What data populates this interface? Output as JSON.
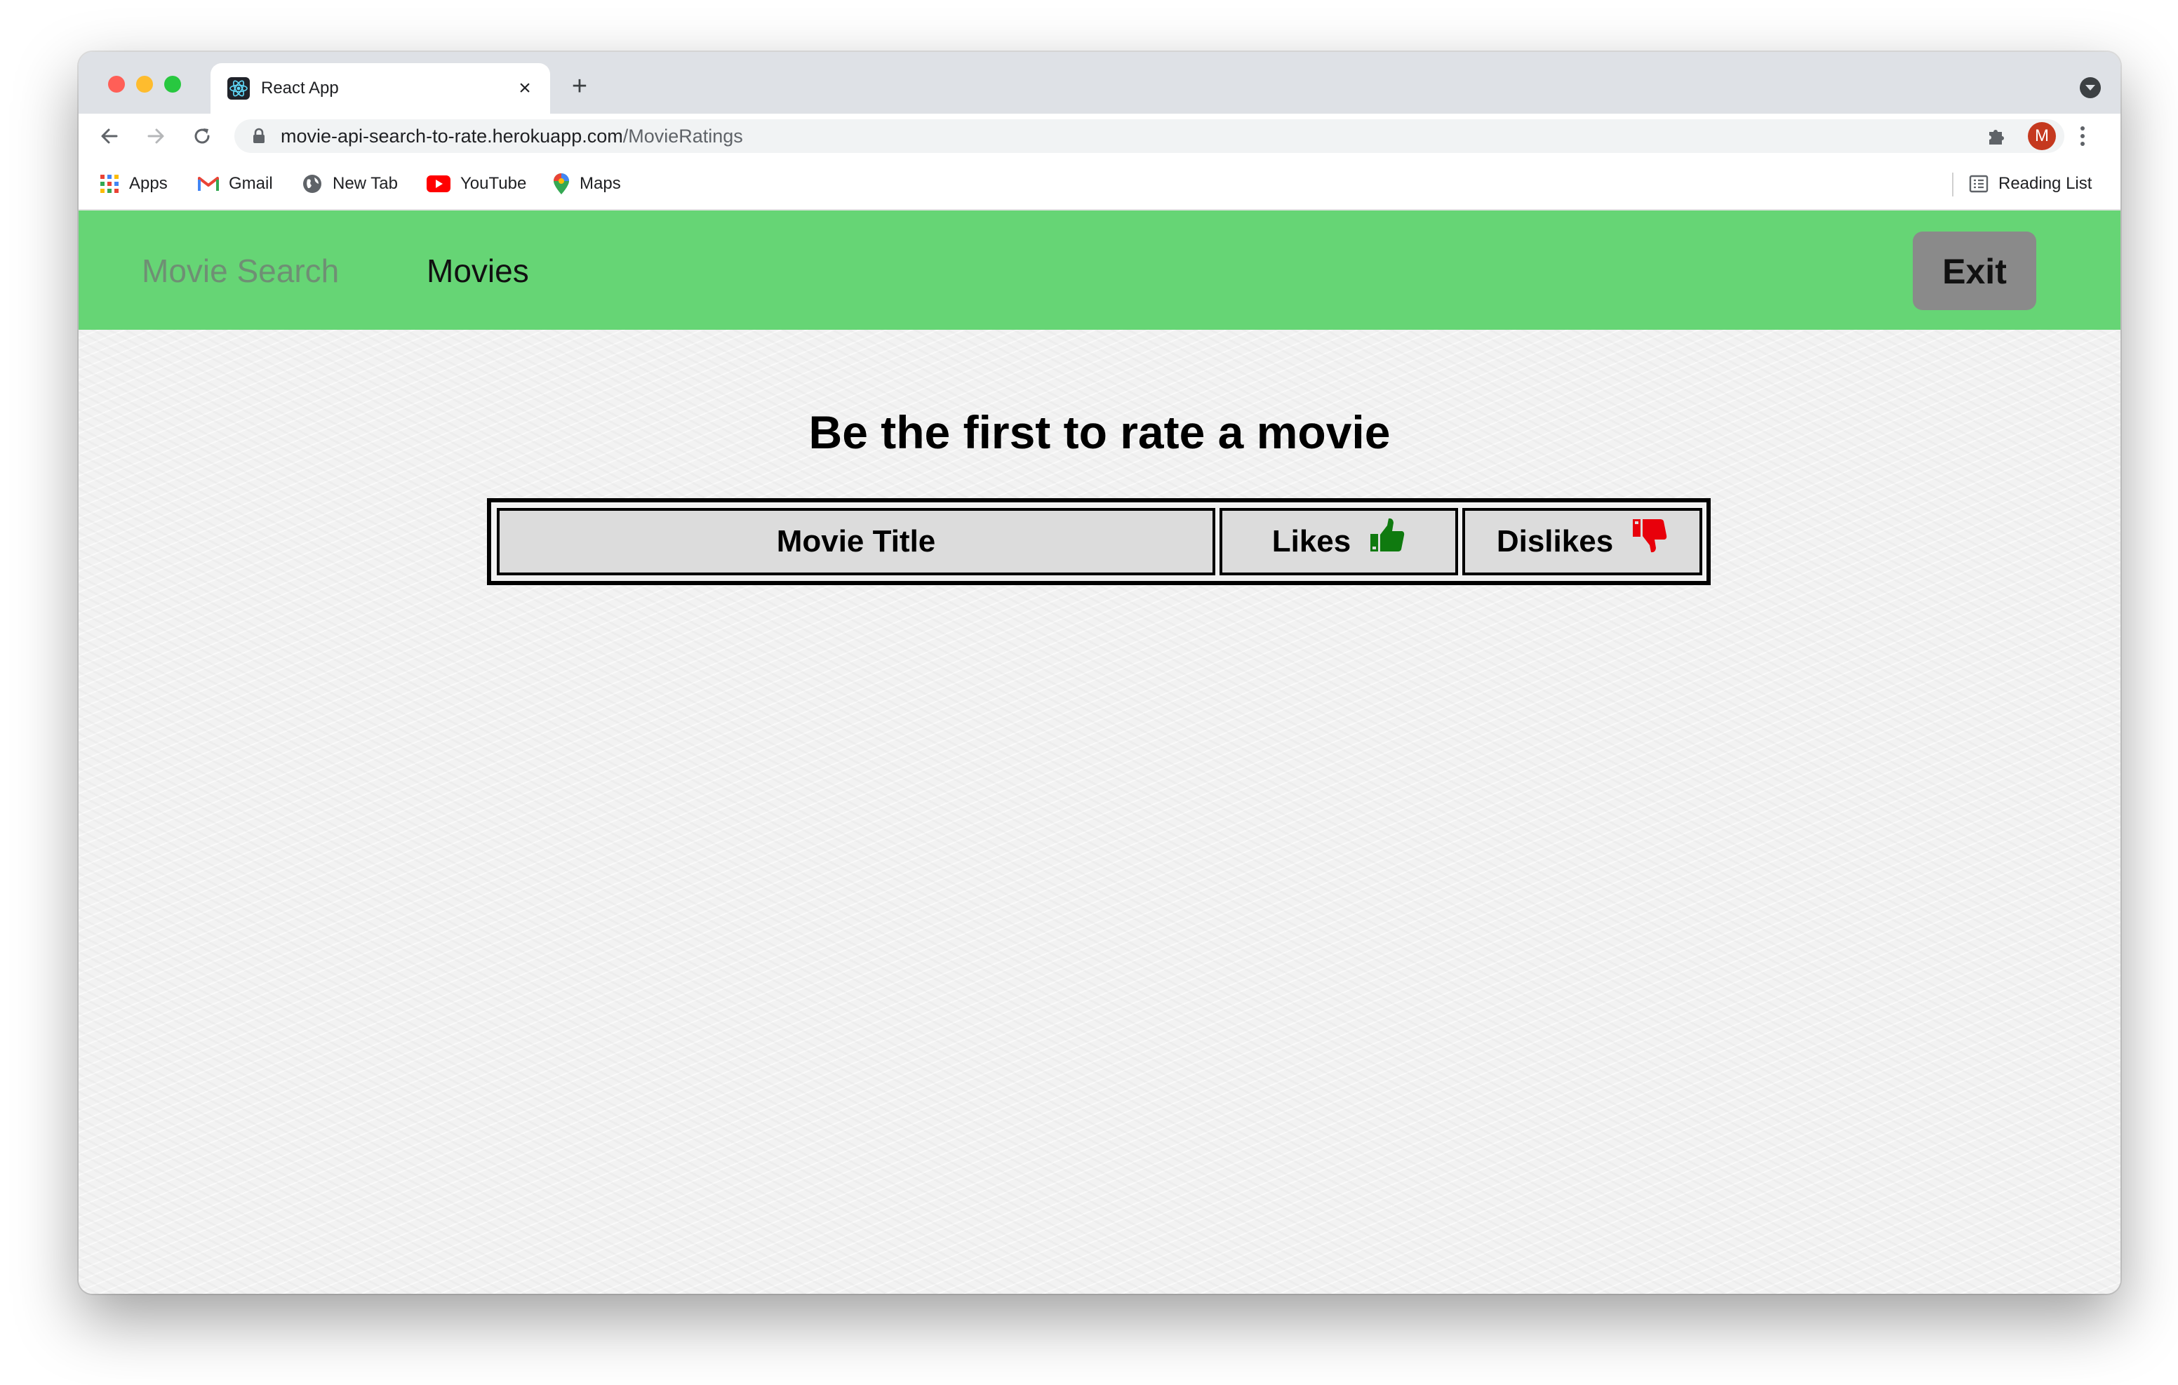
{
  "browser": {
    "tab_title": "React App",
    "tab_close": "×",
    "new_tab": "+",
    "url_host": "movie-api-search-to-rate.herokuapp.com",
    "url_path": "/MovieRatings",
    "avatar_initial": "M",
    "bookmarks": {
      "apps": "Apps",
      "gmail": "Gmail",
      "new_tab": "New Tab",
      "youtube": "YouTube",
      "maps": "Maps",
      "reading_list": "Reading List"
    }
  },
  "navbar": {
    "brand": "Movie Search",
    "movies_link": "Movies",
    "exit_label": "Exit",
    "background": "#66d575"
  },
  "main": {
    "heading": "Be the first to rate a movie",
    "table": {
      "columns": [
        "Movie Title",
        "Likes",
        "Dislikes"
      ],
      "rows": []
    }
  },
  "colors": {
    "like_icon": "#0f7a0f",
    "dislike_icon": "#e8000b",
    "exit_button": "#8a8a8a"
  },
  "icons": {
    "likes": "thumbs-up-icon",
    "dislikes": "thumbs-down-icon"
  }
}
